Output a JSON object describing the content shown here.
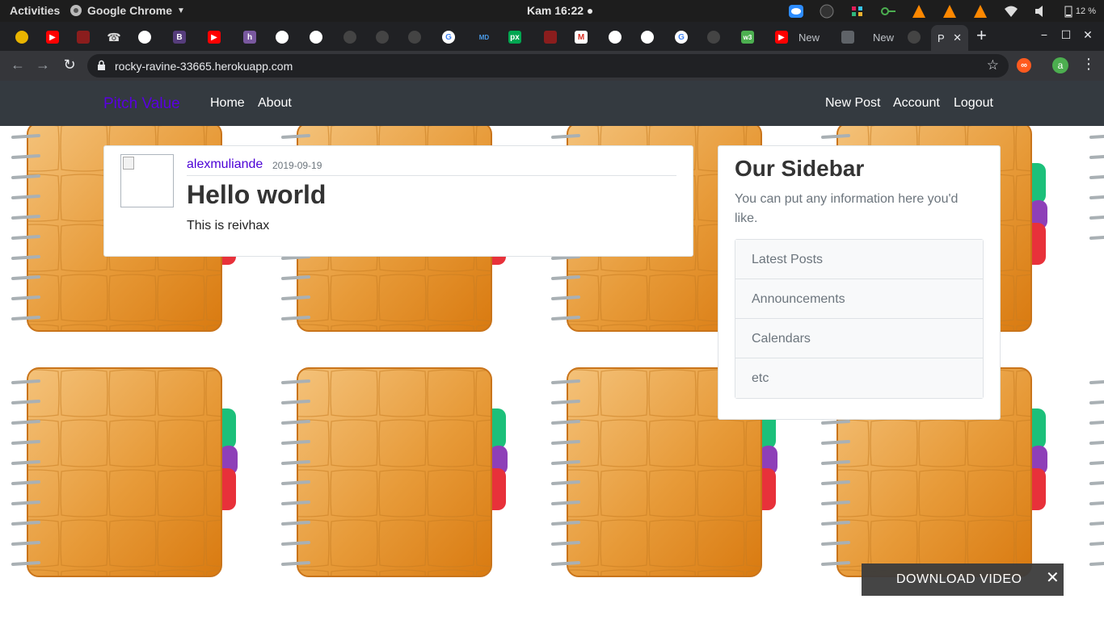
{
  "os_topbar": {
    "activities": "Activities",
    "app_name": "Google Chrome",
    "clock": "Kam 16:22 ●",
    "battery": "12 %"
  },
  "browser": {
    "tab_titles": [
      "New",
      "New"
    ],
    "active_tab_title": "P",
    "url": "rocky-ravine-33665.herokuapp.com",
    "profile_initial": "a"
  },
  "navbar": {
    "brand": "Pitch Value",
    "left_links": [
      "Home",
      "About"
    ],
    "right_links": [
      "New Post",
      "Account",
      "Logout"
    ]
  },
  "post": {
    "author": "alexmuliande",
    "date": "2019-09-19",
    "title": "Hello world",
    "content": "This is reivhax"
  },
  "sidebar": {
    "title": "Our Sidebar",
    "description": "You can put any information here you'd like.",
    "items": [
      "Latest Posts",
      "Announcements",
      "Calendars",
      "etc"
    ]
  },
  "download_bar": {
    "label": "DOWNLOAD VIDEO",
    "close": "✕"
  },
  "colors": {
    "navbar_bg": "#343a40",
    "brand": "#5a00e0",
    "author_link": "#4b00d6",
    "notebook_cover": "#e79a38"
  }
}
